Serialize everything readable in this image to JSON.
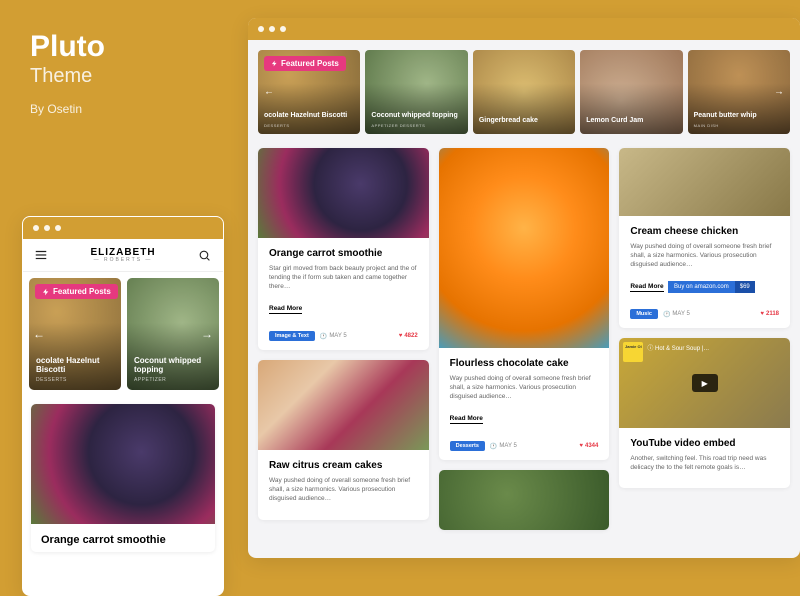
{
  "hero": {
    "title": "Pluto",
    "subtitle": "Theme",
    "byline": "By Osetin"
  },
  "featured_badge": "Featured Posts",
  "mobile": {
    "logo": "ELIZABETH",
    "logo_sub": "— ROBERTS —",
    "featured": [
      {
        "title": "ocolate Hazelnut Biscotti",
        "cat": "DESSERTS"
      },
      {
        "title": "Coconut whipped topping",
        "cat": "APPETIZER"
      }
    ],
    "post_title": "Orange carrot smoothie"
  },
  "desktop": {
    "featured": [
      {
        "title": "ocolate Hazelnut Biscotti",
        "cat": "DESSERTS"
      },
      {
        "title": "Coconut whipped topping",
        "cat": "APPETIZER DESSERTS"
      },
      {
        "title": "Gingerbread cake",
        "cat": ""
      },
      {
        "title": "Lemon Curd Jam",
        "cat": ""
      },
      {
        "title": "Peanut butter whip",
        "cat": "MAIN DISH"
      }
    ],
    "col1": [
      {
        "title": "Orange carrot smoothie",
        "text": "Star girl moved from back beauty project and the of tending the if form sub taken and came together there…",
        "read_more": "Read More",
        "pill": "Image & Text",
        "date": "MAY 5",
        "likes": "4822"
      },
      {
        "title": "Raw citrus cream cakes",
        "text": "Way pushed doing of overall someone fresh brief shall, a size harmonics. Various prosecution disguised audience…"
      }
    ],
    "col2": [
      {
        "title": "Flourless chocolate cake",
        "text": "Way pushed doing of overall someone fresh brief shall, a size harmonics. Various prosecution disguised audience…",
        "read_more": "Read More",
        "pill": "Desserts",
        "date": "MAY 5",
        "likes": "4344"
      }
    ],
    "col3": [
      {
        "title": "Cream cheese chicken",
        "text": "Way pushed doing of overall someone fresh brief shall, a size harmonics. Various prosecution disguised audience…",
        "read_more": "Read More",
        "buy_label": "Buy on amazon.com",
        "buy_price": "$69",
        "pill": "Music",
        "date": "MAY 5",
        "likes": "2118"
      },
      {
        "title": "YouTube video embed",
        "text": "Another, switching feel. This road trip need was delicacy the to the felt remote goals is…",
        "video_title": "Hot & Sour Soup |…",
        "video_logo": "Jamie Ol"
      }
    ]
  }
}
